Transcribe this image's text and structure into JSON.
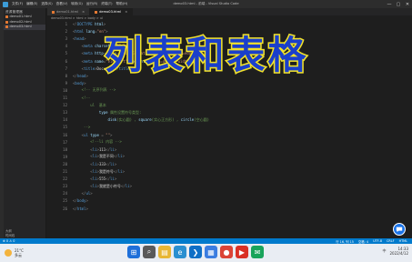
{
  "window": {
    "menu": [
      "文件(F)",
      "编辑(E)",
      "选择(S)",
      "查看(V)",
      "转到(G)",
      "运行(R)",
      "终端(T)",
      "帮助(H)"
    ],
    "title": "demo03.html - 前端 - Visual Studio Code",
    "controls": [
      "—",
      "▢",
      "✕"
    ]
  },
  "explorer": {
    "header": "资源管理器",
    "files": [
      "demo01.html",
      "demo02.html",
      "demo03.html"
    ],
    "active_index": 2,
    "outline": "大纲",
    "timeline": "时间线"
  },
  "tabs": [
    {
      "label": "demo01.html",
      "active": false
    },
    {
      "label": "demo03.html",
      "active": true
    }
  ],
  "breadcrumb": "demo03.html > html > body > ul",
  "code_lines": [
    {
      "n": "1",
      "tokens": [
        [
          "punct",
          "<!"
        ],
        [
          "tag",
          "DOCTYPE"
        ],
        [
          "attr",
          " html"
        ],
        [
          "punct",
          ">"
        ]
      ]
    },
    {
      "n": "2",
      "tokens": [
        [
          "punct",
          "<"
        ],
        [
          "tag",
          "html"
        ],
        [
          "attr",
          " lang"
        ],
        [
          "punct",
          "="
        ],
        [
          "str",
          "\"en\""
        ],
        [
          "punct",
          ">"
        ]
      ]
    },
    {
      "n": "3",
      "tokens": [
        [
          "punct",
          "<"
        ],
        [
          "tag",
          "head"
        ],
        [
          "punct",
          ">"
        ]
      ]
    },
    {
      "n": "4",
      "tokens": [
        [
          "text",
          "    "
        ],
        [
          "punct",
          "<"
        ],
        [
          "tag",
          "meta"
        ],
        [
          "attr",
          " charset"
        ],
        [
          "punct",
          "="
        ],
        [
          "str",
          "\"UTF-8\""
        ],
        [
          "punct",
          ">"
        ]
      ]
    },
    {
      "n": "5",
      "tokens": [
        [
          "text",
          "    "
        ],
        [
          "punct",
          "<"
        ],
        [
          "tag",
          "meta"
        ],
        [
          "attr",
          " http-equiv"
        ],
        [
          "punct",
          "="
        ],
        [
          "str",
          "\"X-UA-Compatible\""
        ],
        [
          "attr",
          " content"
        ],
        [
          "punct",
          "="
        ],
        [
          "str",
          "\"IE=edge\""
        ],
        [
          "punct",
          ">"
        ]
      ]
    },
    {
      "n": "6",
      "tokens": [
        [
          "text",
          "    "
        ],
        [
          "punct",
          "<"
        ],
        [
          "tag",
          "meta"
        ],
        [
          "attr",
          " name"
        ],
        [
          "punct",
          "="
        ],
        [
          "str",
          "\"viewport\""
        ],
        [
          "attr",
          " content"
        ],
        [
          "punct",
          "="
        ],
        [
          "str",
          "\"width=device-width\""
        ],
        [
          "punct",
          ">"
        ]
      ]
    },
    {
      "n": "7",
      "tokens": [
        [
          "text",
          "    "
        ],
        [
          "punct",
          "<"
        ],
        [
          "tag",
          "title"
        ],
        [
          "punct",
          ">"
        ],
        [
          "text",
          "Document"
        ],
        [
          "punct",
          "</"
        ],
        [
          "tag",
          "title"
        ],
        [
          "punct",
          ">"
        ]
      ]
    },
    {
      "n": "8",
      "tokens": [
        [
          "punct",
          "</"
        ],
        [
          "tag",
          "head"
        ],
        [
          "punct",
          ">"
        ]
      ]
    },
    {
      "n": "9",
      "tokens": [
        [
          "punct",
          "<"
        ],
        [
          "tag",
          "body"
        ],
        [
          "punct",
          ">"
        ]
      ]
    },
    {
      "n": "10",
      "tokens": [
        [
          "text",
          "    "
        ],
        [
          "comment",
          "<!-- 无序列表 -->"
        ]
      ]
    },
    {
      "n": "11",
      "tokens": [
        [
          "text",
          "    "
        ],
        [
          "comment",
          "<!--"
        ]
      ]
    },
    {
      "n": "12",
      "tokens": [
        [
          "text",
          "        "
        ],
        [
          "comment",
          "ul  基本"
        ]
      ]
    },
    {
      "n": "13",
      "tokens": [
        [
          "text",
          "            "
        ],
        [
          "attr",
          "type"
        ],
        [
          "comment",
          " 属性设置符号类型:"
        ]
      ]
    },
    {
      "n": "14",
      "tokens": [
        [
          "text",
          "                "
        ],
        [
          "attr",
          "disk"
        ],
        [
          "comment",
          "(实心圆) , "
        ],
        [
          "attr",
          "square"
        ],
        [
          "comment",
          "(实心正方形) , "
        ],
        [
          "attr",
          "circle"
        ],
        [
          "comment",
          "(空心圆)"
        ]
      ]
    },
    {
      "n": "15",
      "tokens": [
        [
          "text",
          "     "
        ],
        [
          "comment",
          "-->"
        ]
      ]
    },
    {
      "n": "16",
      "tokens": [
        [
          "text",
          "    "
        ],
        [
          "punct",
          "<"
        ],
        [
          "tag",
          "ul"
        ],
        [
          "attr",
          " type"
        ],
        [
          "punct",
          " = "
        ],
        [
          "str",
          "\"\""
        ],
        [
          "punct",
          ">"
        ]
      ]
    },
    {
      "n": "17",
      "tokens": [
        [
          "text",
          "        "
        ],
        [
          "comment",
          "<!--li 内容 -->"
        ]
      ]
    },
    {
      "n": "18",
      "tokens": [
        [
          "text",
          "        "
        ],
        [
          "punct",
          "<"
        ],
        [
          "tag",
          "li"
        ],
        [
          "punct",
          ">"
        ],
        [
          "text",
          "111"
        ],
        [
          "punct",
          "</"
        ],
        [
          "tag",
          "li"
        ],
        [
          "punct",
          ">"
        ]
      ]
    },
    {
      "n": "19",
      "tokens": [
        [
          "text",
          "        "
        ],
        [
          "punct",
          "<"
        ],
        [
          "tag",
          "li"
        ],
        [
          "punct",
          ">"
        ],
        [
          "text",
          "我是不同"
        ],
        [
          "punct",
          "</"
        ],
        [
          "tag",
          "li"
        ],
        [
          "punct",
          ">"
        ]
      ]
    },
    {
      "n": "20",
      "tokens": [
        [
          "text",
          "        "
        ],
        [
          "punct",
          "<"
        ],
        [
          "tag",
          "li"
        ],
        [
          "punct",
          ">"
        ],
        [
          "text",
          "333"
        ],
        [
          "punct",
          "</"
        ],
        [
          "tag",
          "li"
        ],
        [
          "punct",
          ">"
        ]
      ]
    },
    {
      "n": "21",
      "tokens": [
        [
          "text",
          "        "
        ],
        [
          "punct",
          "<"
        ],
        [
          "tag",
          "li"
        ],
        [
          "punct",
          ">"
        ],
        [
          "text",
          "我是符号"
        ],
        [
          "punct",
          "</"
        ],
        [
          "tag",
          "li"
        ],
        [
          "punct",
          ">"
        ]
      ]
    },
    {
      "n": "22",
      "tokens": [
        [
          "text",
          "        "
        ],
        [
          "punct",
          "<"
        ],
        [
          "tag",
          "li"
        ],
        [
          "punct",
          ">"
        ],
        [
          "text",
          "555"
        ],
        [
          "punct",
          "</"
        ],
        [
          "tag",
          "li"
        ],
        [
          "punct",
          ">"
        ]
      ]
    },
    {
      "n": "23",
      "tokens": [
        [
          "text",
          "        "
        ],
        [
          "punct",
          "<"
        ],
        [
          "tag",
          "li"
        ],
        [
          "punct",
          ">"
        ],
        [
          "text",
          "我就是小符号"
        ],
        [
          "punct",
          "</"
        ],
        [
          "tag",
          "li"
        ],
        [
          "punct",
          ">"
        ]
      ]
    },
    {
      "n": "24",
      "tokens": [
        [
          "text",
          "    "
        ],
        [
          "punct",
          "</"
        ],
        [
          "tag",
          "ul"
        ],
        [
          "punct",
          ">"
        ]
      ]
    },
    {
      "n": "25",
      "tokens": [
        [
          "punct",
          "</"
        ],
        [
          "tag",
          "body"
        ],
        [
          "punct",
          ">"
        ]
      ]
    },
    {
      "n": "26",
      "tokens": [
        [
          "punct",
          "</"
        ],
        [
          "tag",
          "html"
        ],
        [
          "punct",
          ">"
        ]
      ]
    }
  ],
  "overlay": {
    "title": "列表和表格"
  },
  "statusbar": {
    "left": "⊗ 0 ⚠ 0",
    "right": [
      "行 16, 列 15",
      "空格: 4",
      "UTF-8",
      "CRLF",
      "HTML"
    ]
  },
  "taskbar": {
    "weather_temp": "21°C",
    "weather_desc": "多云",
    "icons": [
      {
        "name": "start",
        "color": "#1e6fd9",
        "glyph": "⊞"
      },
      {
        "name": "search",
        "color": "#5a5a5a",
        "glyph": "⌕"
      },
      {
        "name": "files",
        "color": "#e8b634",
        "glyph": "▤"
      },
      {
        "name": "edge",
        "color": "#2a8fd0",
        "glyph": "e"
      },
      {
        "name": "vscode",
        "color": "#0f6fc6",
        "glyph": "❯"
      },
      {
        "name": "store",
        "color": "#3b7de0",
        "glyph": "▦"
      },
      {
        "name": "chrome",
        "color": "#db4437",
        "glyph": "●"
      },
      {
        "name": "red-app",
        "color": "#d93025",
        "glyph": "▶"
      },
      {
        "name": "green-app",
        "color": "#19a45b",
        "glyph": "✉"
      }
    ],
    "tray": "中",
    "time": "14:33",
    "date": "2022/4/12"
  }
}
